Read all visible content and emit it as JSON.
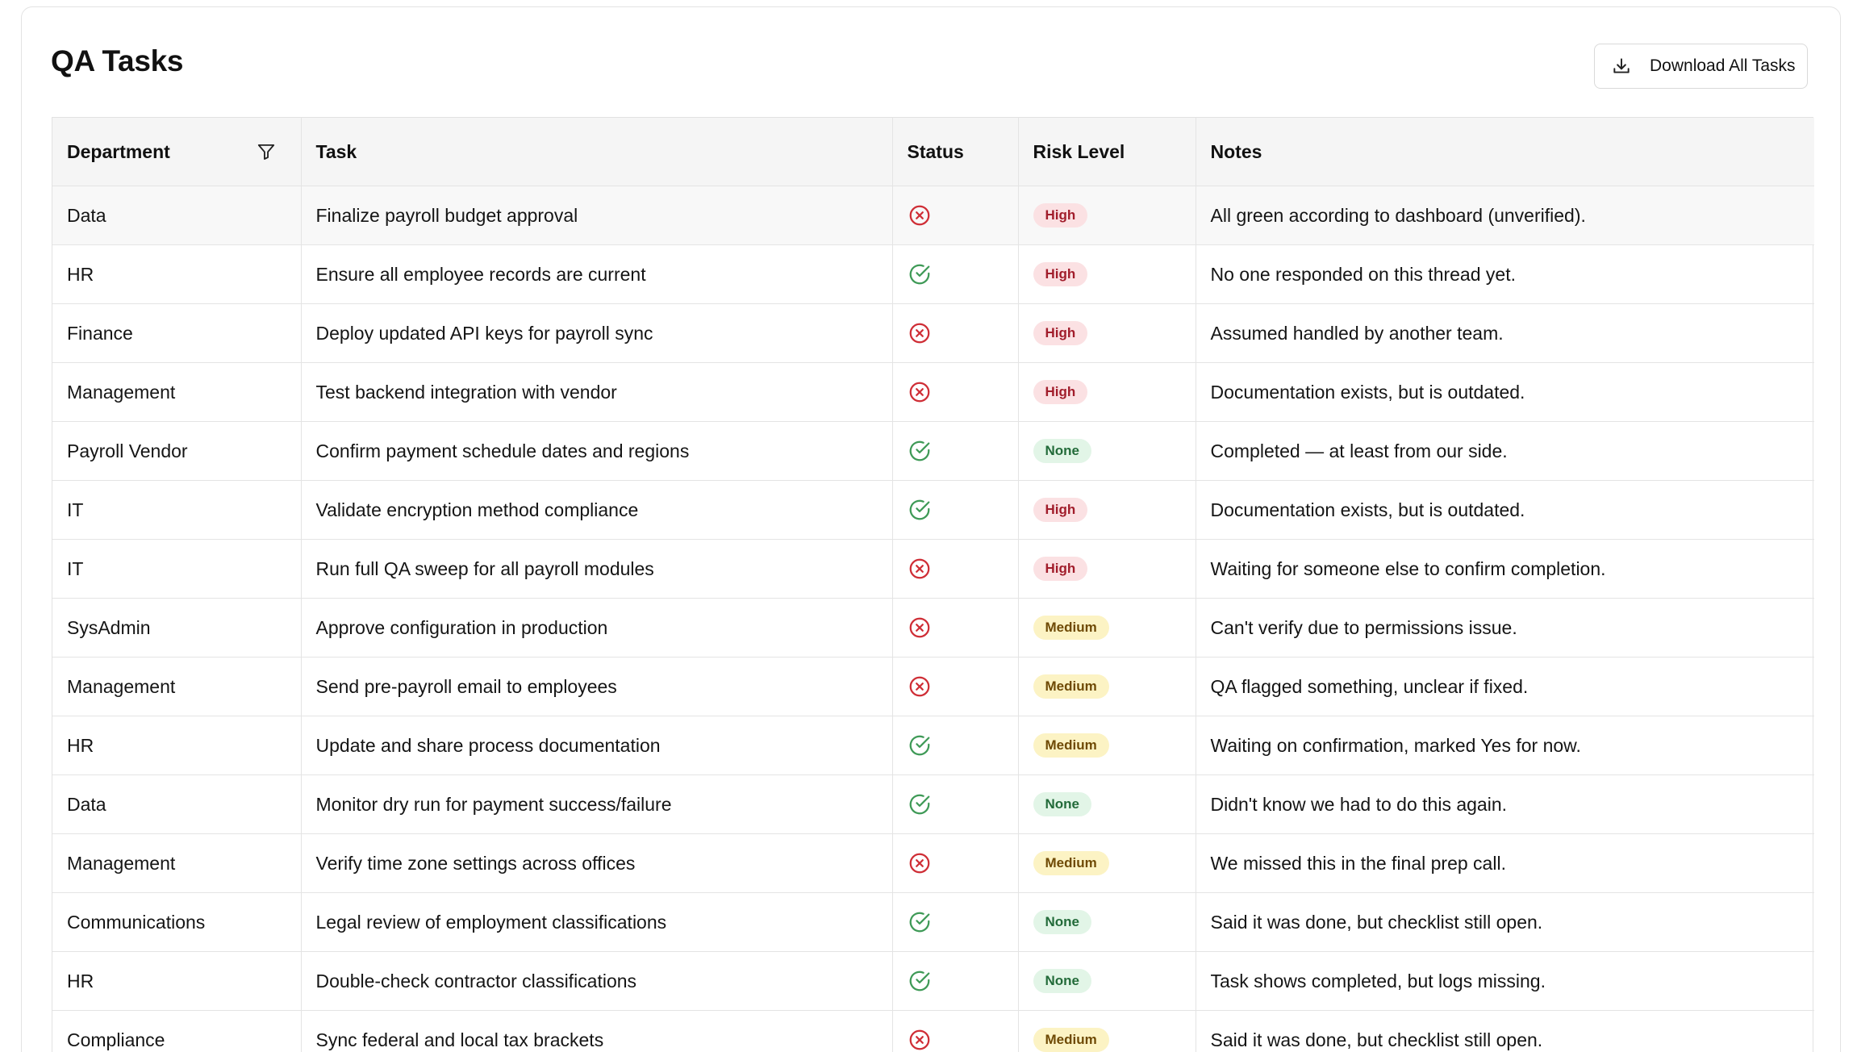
{
  "page": {
    "title": "QA Tasks",
    "download_label": "Download All Tasks"
  },
  "table": {
    "columns": [
      "Department",
      "Task",
      "Status",
      "Risk Level",
      "Notes"
    ],
    "rows": [
      {
        "department": "Data",
        "task": "Finalize payroll budget approval",
        "status": "failed",
        "risk": "High",
        "notes": "All green according to dashboard (unverified)."
      },
      {
        "department": "HR",
        "task": "Ensure all employee records are current",
        "status": "passed",
        "risk": "High",
        "notes": "No one responded on this thread yet."
      },
      {
        "department": "Finance",
        "task": "Deploy updated API keys for payroll sync",
        "status": "failed",
        "risk": "High",
        "notes": "Assumed handled by another team."
      },
      {
        "department": "Management",
        "task": "Test backend integration with vendor",
        "status": "failed",
        "risk": "High",
        "notes": "Documentation exists, but is outdated."
      },
      {
        "department": "Payroll Vendor",
        "task": "Confirm payment schedule dates and regions",
        "status": "passed",
        "risk": "None",
        "notes": "Completed — at least from our side."
      },
      {
        "department": "IT",
        "task": "Validate encryption method compliance",
        "status": "passed",
        "risk": "High",
        "notes": "Documentation exists, but is outdated."
      },
      {
        "department": "IT",
        "task": "Run full QA sweep for all payroll modules",
        "status": "failed",
        "risk": "High",
        "notes": "Waiting for someone else to confirm completion."
      },
      {
        "department": "SysAdmin",
        "task": "Approve configuration in production",
        "status": "failed",
        "risk": "Medium",
        "notes": "Can't verify due to permissions issue."
      },
      {
        "department": "Management",
        "task": "Send pre-payroll email to employees",
        "status": "failed",
        "risk": "Medium",
        "notes": "QA flagged something, unclear if fixed."
      },
      {
        "department": "HR",
        "task": "Update and share process documentation",
        "status": "passed",
        "risk": "Medium",
        "notes": "Waiting on confirmation, marked Yes for now."
      },
      {
        "department": "Data",
        "task": "Monitor dry run for payment success/failure",
        "status": "passed",
        "risk": "None",
        "notes": "Didn't know we had to do this again."
      },
      {
        "department": "Management",
        "task": "Verify time zone settings across offices",
        "status": "failed",
        "risk": "Medium",
        "notes": "We missed this in the final prep call."
      },
      {
        "department": "Communications",
        "task": "Legal review of employment classifications",
        "status": "passed",
        "risk": "None",
        "notes": "Said it was done, but checklist still open."
      },
      {
        "department": "HR",
        "task": "Double-check contractor classifications",
        "status": "passed",
        "risk": "None",
        "notes": "Task shows completed, but logs missing."
      },
      {
        "department": "Compliance",
        "task": "Sync federal and local tax brackets",
        "status": "failed",
        "risk": "Medium",
        "notes": "Said it was done, but checklist still open."
      }
    ]
  },
  "colors": {
    "passed": "#3f9a57",
    "failed": "#cf2e36"
  }
}
